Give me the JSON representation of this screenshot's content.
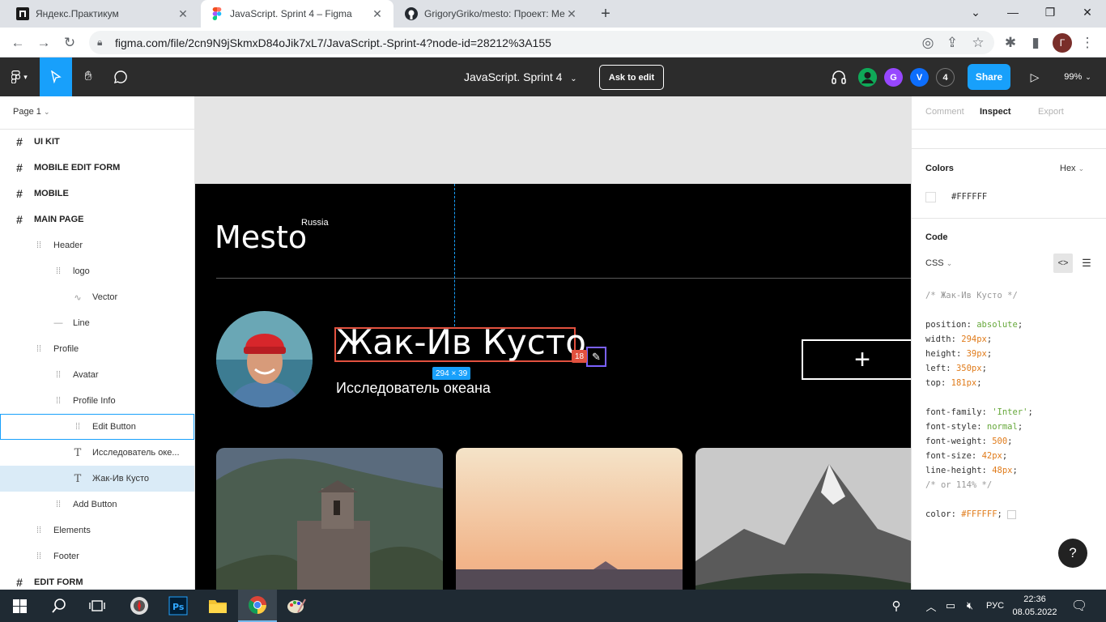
{
  "browser": {
    "tabs": [
      {
        "title": "Яндекс.Практикум",
        "icon": "practicum-icon",
        "active": false
      },
      {
        "title": "JavaScript. Sprint 4 – Figma",
        "icon": "figma-icon",
        "active": true
      },
      {
        "title": "GrigoryGriko/mesto: Проект: Ме",
        "icon": "github-icon",
        "active": false
      }
    ],
    "new_tab": "+",
    "url": "figma.com/file/2cn9N9jSkmxD84oJik7xL7/JavaScript.-Sprint-4?node-id=28212%3A155",
    "profile_initial": "Г"
  },
  "figma": {
    "doc_title": "JavaScript. Sprint 4",
    "ask_to_edit": "Ask to edit",
    "avatars": [
      "G",
      "V"
    ],
    "viewer_count": "4",
    "share": "Share",
    "zoom": "99%",
    "page_selector": "Page 1",
    "layers": [
      {
        "label": "UI KIT",
        "depth": 0,
        "icon": "frame-icon",
        "bold": true
      },
      {
        "label": "MOBILE EDIT FORM",
        "depth": 0,
        "icon": "frame-icon",
        "bold": true
      },
      {
        "label": "MOBILE",
        "depth": 0,
        "icon": "frame-icon",
        "bold": true
      },
      {
        "label": "MAIN PAGE",
        "depth": 0,
        "icon": "frame-icon",
        "bold": true
      },
      {
        "label": "Header",
        "depth": 1,
        "icon": "group-icon"
      },
      {
        "label": "logo",
        "depth": 2,
        "icon": "group-icon"
      },
      {
        "label": "Vector",
        "depth": 3,
        "icon": "vector-icon"
      },
      {
        "label": "Line",
        "depth": 2,
        "icon": "line-icon"
      },
      {
        "label": "Profile",
        "depth": 1,
        "icon": "group-icon"
      },
      {
        "label": "Avatar",
        "depth": 2,
        "icon": "group-icon"
      },
      {
        "label": "Profile Info",
        "depth": 2,
        "icon": "group-icon"
      },
      {
        "label": "Edit Button",
        "depth": 3,
        "icon": "group-icon",
        "hover": true
      },
      {
        "label": "Исследователь оке...",
        "depth": 3,
        "icon": "text-icon"
      },
      {
        "label": "Жак-Ив Кусто",
        "depth": 3,
        "icon": "text-icon",
        "selected": true
      },
      {
        "label": "Add Button",
        "depth": 2,
        "icon": "group-icon"
      },
      {
        "label": "Elements",
        "depth": 1,
        "icon": "group-icon"
      },
      {
        "label": "Footer",
        "depth": 1,
        "icon": "group-icon"
      },
      {
        "label": "EDIT FORM",
        "depth": 0,
        "icon": "frame-icon",
        "bold": true
      }
    ],
    "right_tabs": [
      "Comment",
      "Inspect",
      "Export"
    ],
    "colors_heading": "Colors",
    "color_format": "Hex",
    "color_value": "#FFFFFF",
    "code_heading": "Code",
    "code_lang": "CSS",
    "css_comment": "/* Жак-Ив Кусто */",
    "css": [
      {
        "prop": "position",
        "value": "absolute"
      },
      {
        "prop": "width",
        "value": "294px"
      },
      {
        "prop": "height",
        "value": "39px"
      },
      {
        "prop": "left",
        "value": "350px"
      },
      {
        "prop": "top",
        "value": "181px"
      },
      {
        "prop": "font-family",
        "value": "'Inter'"
      },
      {
        "prop": "font-style",
        "value": "normal"
      },
      {
        "prop": "font-weight",
        "value": "500"
      },
      {
        "prop": "font-size",
        "value": "42px"
      },
      {
        "prop": "line-height",
        "value": "48px"
      },
      {
        "prop": "color",
        "value": "#FFFFFF"
      }
    ],
    "line_height_note": "/* or 114% */",
    "help": "?"
  },
  "mesto": {
    "logo": "Mesto",
    "logo_sub": "Russia",
    "name": "Жак-Ив Кусто",
    "about": "Исследователь океана",
    "size_badge": "294 × 39",
    "spacing_badge": "18",
    "add_button": "+"
  },
  "taskbar": {
    "lang": "РУС",
    "time": "22:36",
    "date": "08.05.2022"
  }
}
